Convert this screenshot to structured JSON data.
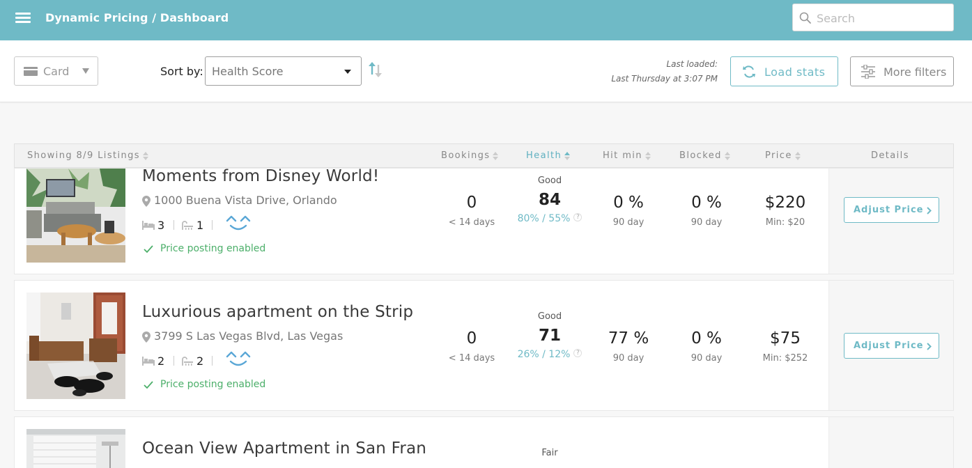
{
  "header": {
    "breadcrumb": "Dynamic Pricing / Dashboard",
    "search_placeholder": "Search"
  },
  "toolbar": {
    "view_label": "Card",
    "sort_label": "Sort by:",
    "sort_value": "Health Score",
    "last_loaded_label": "Last loaded:",
    "last_loaded_value": "Last Thursday at 3:07 PM",
    "load_stats_label": "Load stats",
    "more_filters_label": "More filters"
  },
  "table": {
    "columns": {
      "listings": "Showing 8/9 Listings",
      "bookings": "Bookings",
      "health": "Health",
      "hit_min": "Hit min",
      "blocked": "Blocked",
      "price": "Price",
      "details": "Details"
    },
    "rows": [
      {
        "title": "Moments from Disney World!",
        "address": "1000 Buena Vista Drive, Orlando",
        "beds": "3",
        "baths": "1",
        "posting": "Price posting enabled",
        "bookings": "0",
        "bookings_sub": "< 14 days",
        "health_label": "Good",
        "health_score": "84",
        "health_sub": "80% / 55%",
        "hit_min": "0 %",
        "hit_min_sub": "90 day",
        "blocked": "0 %",
        "blocked_sub": "90 day",
        "price": "$220",
        "price_sub": "Min: $20",
        "action": "Adjust Price"
      },
      {
        "title": "Luxurious apartment on the Strip",
        "address": "3799 S Las Vegas Blvd, Las Vegas",
        "beds": "2",
        "baths": "2",
        "posting": "Price posting enabled",
        "bookings": "0",
        "bookings_sub": "< 14 days",
        "health_label": "Good",
        "health_score": "71",
        "health_sub": "26% / 12%",
        "hit_min": "77 %",
        "hit_min_sub": "90 day",
        "blocked": "0 %",
        "blocked_sub": "90 day",
        "price": "$75",
        "price_sub": "Min: $252",
        "action": "Adjust Price"
      },
      {
        "title": "Ocean View Apartment in San Fran",
        "health_label": "Fair"
      }
    ],
    "help_mark": "?"
  },
  "colors": {
    "header_bg": "#6fbac6",
    "accent": "#6fbac6",
    "success": "#4caf6a"
  }
}
